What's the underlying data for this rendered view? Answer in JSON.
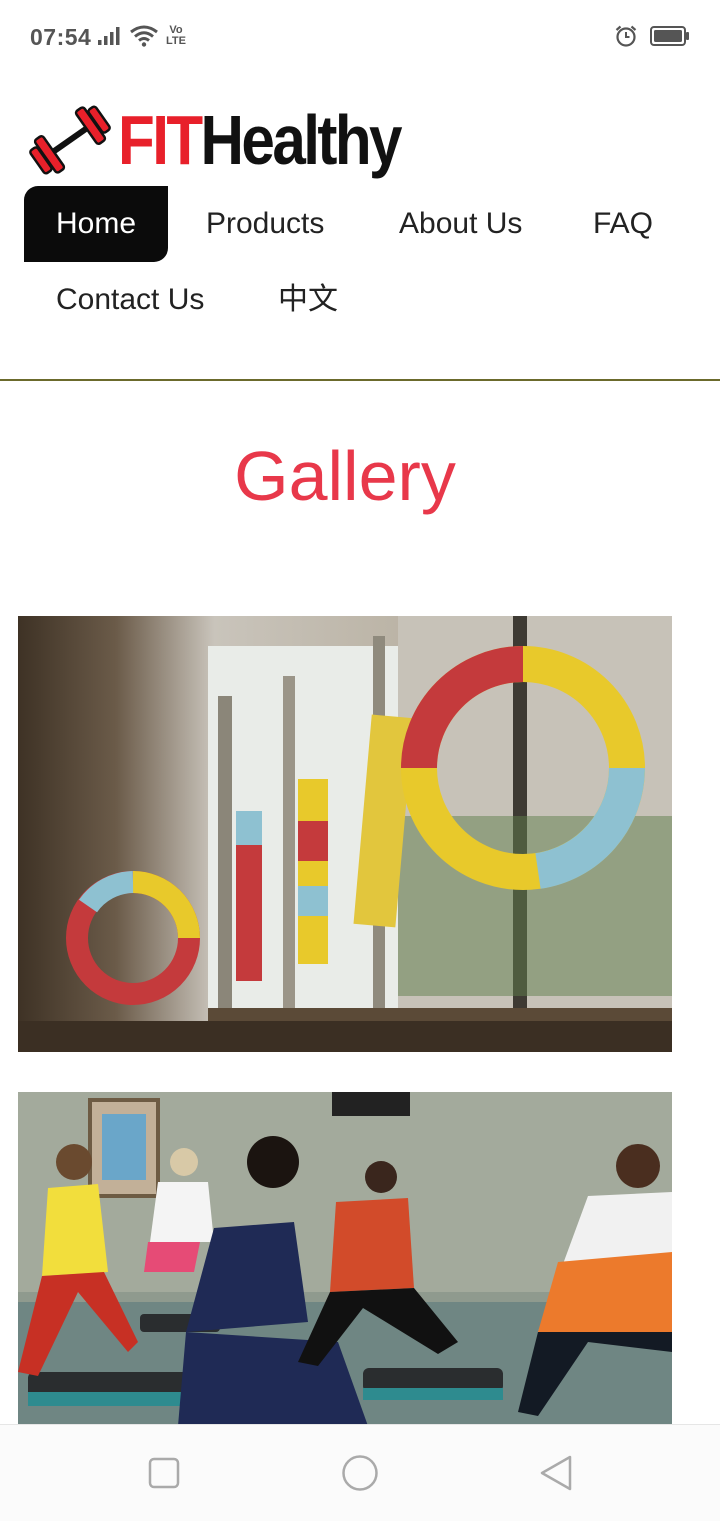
{
  "status_bar": {
    "time": "07:54",
    "volte_top": "Vo",
    "volte_bottom": "LTE",
    "icons": [
      "signal-icon",
      "wifi-icon",
      "volte-icon",
      "alarm-icon",
      "battery-icon"
    ]
  },
  "logo": {
    "part1": "FIT",
    "part2": "Healthy",
    "icon": "barbell-icon"
  },
  "nav": {
    "items": [
      {
        "label": "Home",
        "active": true
      },
      {
        "label": "Products"
      },
      {
        "label": "About Us"
      },
      {
        "label": "FAQ"
      },
      {
        "label": "Contact Us"
      },
      {
        "label": "中文"
      }
    ]
  },
  "gallery": {
    "title": "Gallery",
    "photos": [
      "gym-window-decoration-photo",
      "step-aerobics-class-photo"
    ]
  },
  "colors": {
    "accent_red": "#e8384a",
    "logo_red": "#e8202a",
    "nav_active_bg": "#0b0b0b",
    "divider": "#6b6a2c"
  },
  "system_nav": [
    "recents-button",
    "home-button",
    "back-button"
  ]
}
